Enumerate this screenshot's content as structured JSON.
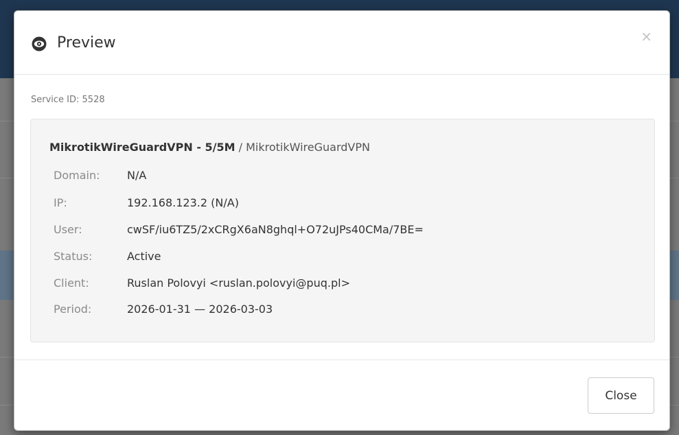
{
  "modal": {
    "title": "Preview",
    "close_symbol": "×",
    "service_id": "Service ID: 5528",
    "product": {
      "name": "MikrotikWireGuardVPN - 5/5M",
      "separator": " / ",
      "group": "MikrotikWireGuardVPN"
    },
    "details": [
      {
        "label": "Domain:",
        "value": "N/A"
      },
      {
        "label": "IP:",
        "value": "192.168.123.2 (N/A)"
      },
      {
        "label": "User:",
        "value": "cwSF/iu6TZ5/2xCRgX6aN8ghql+O72uJPs40CMa/7BE="
      },
      {
        "label": "Status:",
        "value": "Active"
      },
      {
        "label": "Client:",
        "value": "Ruslan Polovyi <ruslan.polovyi@puq.pl>"
      },
      {
        "label": "Period:",
        "value": "2026-01-31 — 2026-03-03"
      }
    ],
    "footer": {
      "close_label": "Close"
    }
  },
  "icons": {
    "title_icon": "eye-icon",
    "dismiss_icon": "close-icon"
  },
  "colors": {
    "header_bar": "#1f3650",
    "backdrop": "#7a7a7a",
    "well_background": "#f5f5f5"
  }
}
